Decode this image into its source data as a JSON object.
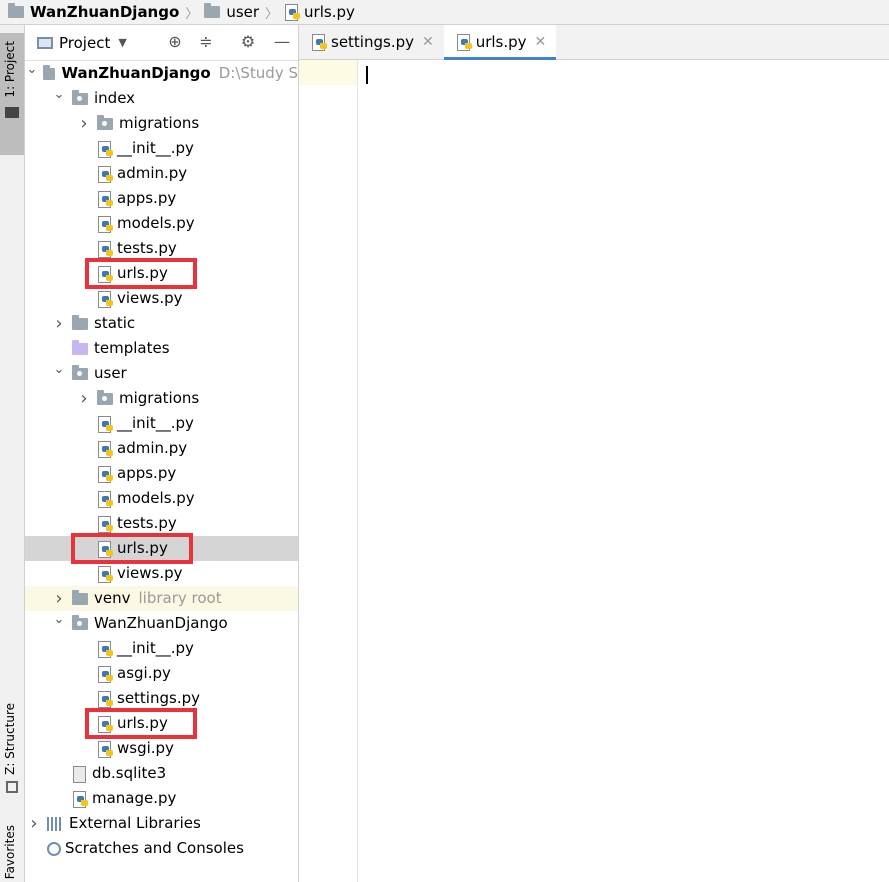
{
  "breadcrumb": {
    "project": "WanZhuanDjango",
    "folder": "user",
    "file": "urls.py"
  },
  "side_strip": {
    "project_tab": "1: Project",
    "structure_tab": "Z: Structure",
    "favorites_tab": "Favorites"
  },
  "project_panel": {
    "view_label": "Project",
    "icons": [
      "locate-icon",
      "collapse-icon",
      "gear-icon",
      "minimize-icon"
    ],
    "tree": [
      {
        "label": "WanZhuanDjango",
        "extra": "D:\\Study S",
        "type": "folder",
        "indent": 0,
        "arrow": "down",
        "bold": true
      },
      {
        "label": "index",
        "type": "package",
        "indent": 1,
        "arrow": "down"
      },
      {
        "label": "migrations",
        "type": "package",
        "indent": 2,
        "arrow": "right"
      },
      {
        "label": "__init__.py",
        "type": "py",
        "indent": 2
      },
      {
        "label": "admin.py",
        "type": "py",
        "indent": 2
      },
      {
        "label": "apps.py",
        "type": "py",
        "indent": 2
      },
      {
        "label": "models.py",
        "type": "py",
        "indent": 2
      },
      {
        "label": "tests.py",
        "type": "py",
        "indent": 2
      },
      {
        "label": "urls.py",
        "type": "py",
        "indent": 2,
        "boxed": true
      },
      {
        "label": "views.py",
        "type": "py",
        "indent": 2
      },
      {
        "label": "static",
        "type": "folder",
        "indent": 1,
        "arrow": "right"
      },
      {
        "label": "templates",
        "type": "template",
        "indent": 1
      },
      {
        "label": "user",
        "type": "package",
        "indent": 1,
        "arrow": "down"
      },
      {
        "label": "migrations",
        "type": "package",
        "indent": 2,
        "arrow": "right"
      },
      {
        "label": "__init__.py",
        "type": "py",
        "indent": 2
      },
      {
        "label": "admin.py",
        "type": "py",
        "indent": 2
      },
      {
        "label": "apps.py",
        "type": "py",
        "indent": 2
      },
      {
        "label": "models.py",
        "type": "py",
        "indent": 2
      },
      {
        "label": "tests.py",
        "type": "py",
        "indent": 2
      },
      {
        "label": "urls.py",
        "type": "py",
        "indent": 2,
        "selected": true,
        "boxed": true
      },
      {
        "label": "views.py",
        "type": "py",
        "indent": 2
      },
      {
        "label": "venv",
        "extra": "library root",
        "type": "folder",
        "indent": 1,
        "arrow": "right",
        "highlight": true
      },
      {
        "label": "WanZhuanDjango",
        "type": "package",
        "indent": 1,
        "arrow": "down"
      },
      {
        "label": "__init__.py",
        "type": "py",
        "indent": 2
      },
      {
        "label": "asgi.py",
        "type": "py",
        "indent": 2
      },
      {
        "label": "settings.py",
        "type": "py",
        "indent": 2
      },
      {
        "label": "urls.py",
        "type": "py",
        "indent": 2,
        "boxed": true
      },
      {
        "label": "wsgi.py",
        "type": "py",
        "indent": 2
      },
      {
        "label": "db.sqlite3",
        "type": "db",
        "indent": 1
      },
      {
        "label": "manage.py",
        "type": "py",
        "indent": 1
      },
      {
        "label": "External Libraries",
        "type": "lib",
        "indent": 0,
        "arrow": "right"
      },
      {
        "label": "Scratches and Consoles",
        "type": "scratch",
        "indent": 0
      }
    ]
  },
  "editor": {
    "tabs": [
      {
        "label": "settings.py",
        "active": false
      },
      {
        "label": "urls.py",
        "active": true
      }
    ]
  }
}
